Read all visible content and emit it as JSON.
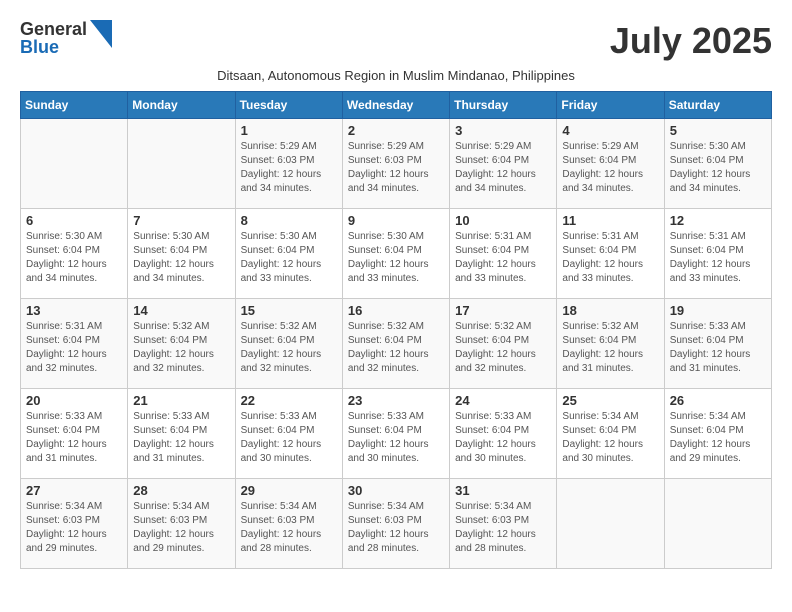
{
  "header": {
    "logo_general": "General",
    "logo_blue": "Blue",
    "month_title": "July 2025",
    "subtitle": "Ditsaan, Autonomous Region in Muslim Mindanao, Philippines"
  },
  "calendar": {
    "days_of_week": [
      "Sunday",
      "Monday",
      "Tuesday",
      "Wednesday",
      "Thursday",
      "Friday",
      "Saturday"
    ],
    "weeks": [
      [
        {
          "day": "",
          "info": ""
        },
        {
          "day": "",
          "info": ""
        },
        {
          "day": "1",
          "info": "Sunrise: 5:29 AM\nSunset: 6:03 PM\nDaylight: 12 hours and 34 minutes."
        },
        {
          "day": "2",
          "info": "Sunrise: 5:29 AM\nSunset: 6:03 PM\nDaylight: 12 hours and 34 minutes."
        },
        {
          "day": "3",
          "info": "Sunrise: 5:29 AM\nSunset: 6:04 PM\nDaylight: 12 hours and 34 minutes."
        },
        {
          "day": "4",
          "info": "Sunrise: 5:29 AM\nSunset: 6:04 PM\nDaylight: 12 hours and 34 minutes."
        },
        {
          "day": "5",
          "info": "Sunrise: 5:30 AM\nSunset: 6:04 PM\nDaylight: 12 hours and 34 minutes."
        }
      ],
      [
        {
          "day": "6",
          "info": "Sunrise: 5:30 AM\nSunset: 6:04 PM\nDaylight: 12 hours and 34 minutes."
        },
        {
          "day": "7",
          "info": "Sunrise: 5:30 AM\nSunset: 6:04 PM\nDaylight: 12 hours and 34 minutes."
        },
        {
          "day": "8",
          "info": "Sunrise: 5:30 AM\nSunset: 6:04 PM\nDaylight: 12 hours and 33 minutes."
        },
        {
          "day": "9",
          "info": "Sunrise: 5:30 AM\nSunset: 6:04 PM\nDaylight: 12 hours and 33 minutes."
        },
        {
          "day": "10",
          "info": "Sunrise: 5:31 AM\nSunset: 6:04 PM\nDaylight: 12 hours and 33 minutes."
        },
        {
          "day": "11",
          "info": "Sunrise: 5:31 AM\nSunset: 6:04 PM\nDaylight: 12 hours and 33 minutes."
        },
        {
          "day": "12",
          "info": "Sunrise: 5:31 AM\nSunset: 6:04 PM\nDaylight: 12 hours and 33 minutes."
        }
      ],
      [
        {
          "day": "13",
          "info": "Sunrise: 5:31 AM\nSunset: 6:04 PM\nDaylight: 12 hours and 32 minutes."
        },
        {
          "day": "14",
          "info": "Sunrise: 5:32 AM\nSunset: 6:04 PM\nDaylight: 12 hours and 32 minutes."
        },
        {
          "day": "15",
          "info": "Sunrise: 5:32 AM\nSunset: 6:04 PM\nDaylight: 12 hours and 32 minutes."
        },
        {
          "day": "16",
          "info": "Sunrise: 5:32 AM\nSunset: 6:04 PM\nDaylight: 12 hours and 32 minutes."
        },
        {
          "day": "17",
          "info": "Sunrise: 5:32 AM\nSunset: 6:04 PM\nDaylight: 12 hours and 32 minutes."
        },
        {
          "day": "18",
          "info": "Sunrise: 5:32 AM\nSunset: 6:04 PM\nDaylight: 12 hours and 31 minutes."
        },
        {
          "day": "19",
          "info": "Sunrise: 5:33 AM\nSunset: 6:04 PM\nDaylight: 12 hours and 31 minutes."
        }
      ],
      [
        {
          "day": "20",
          "info": "Sunrise: 5:33 AM\nSunset: 6:04 PM\nDaylight: 12 hours and 31 minutes."
        },
        {
          "day": "21",
          "info": "Sunrise: 5:33 AM\nSunset: 6:04 PM\nDaylight: 12 hours and 31 minutes."
        },
        {
          "day": "22",
          "info": "Sunrise: 5:33 AM\nSunset: 6:04 PM\nDaylight: 12 hours and 30 minutes."
        },
        {
          "day": "23",
          "info": "Sunrise: 5:33 AM\nSunset: 6:04 PM\nDaylight: 12 hours and 30 minutes."
        },
        {
          "day": "24",
          "info": "Sunrise: 5:33 AM\nSunset: 6:04 PM\nDaylight: 12 hours and 30 minutes."
        },
        {
          "day": "25",
          "info": "Sunrise: 5:34 AM\nSunset: 6:04 PM\nDaylight: 12 hours and 30 minutes."
        },
        {
          "day": "26",
          "info": "Sunrise: 5:34 AM\nSunset: 6:04 PM\nDaylight: 12 hours and 29 minutes."
        }
      ],
      [
        {
          "day": "27",
          "info": "Sunrise: 5:34 AM\nSunset: 6:03 PM\nDaylight: 12 hours and 29 minutes."
        },
        {
          "day": "28",
          "info": "Sunrise: 5:34 AM\nSunset: 6:03 PM\nDaylight: 12 hours and 29 minutes."
        },
        {
          "day": "29",
          "info": "Sunrise: 5:34 AM\nSunset: 6:03 PM\nDaylight: 12 hours and 28 minutes."
        },
        {
          "day": "30",
          "info": "Sunrise: 5:34 AM\nSunset: 6:03 PM\nDaylight: 12 hours and 28 minutes."
        },
        {
          "day": "31",
          "info": "Sunrise: 5:34 AM\nSunset: 6:03 PM\nDaylight: 12 hours and 28 minutes."
        },
        {
          "day": "",
          "info": ""
        },
        {
          "day": "",
          "info": ""
        }
      ]
    ]
  }
}
